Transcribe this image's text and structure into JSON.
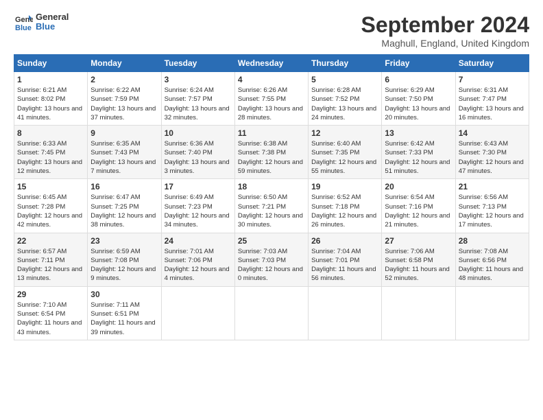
{
  "header": {
    "logo_line1": "General",
    "logo_line2": "Blue",
    "title": "September 2024",
    "location": "Maghull, England, United Kingdom"
  },
  "weekdays": [
    "Sunday",
    "Monday",
    "Tuesday",
    "Wednesday",
    "Thursday",
    "Friday",
    "Saturday"
  ],
  "weeks": [
    [
      {
        "day": "1",
        "sunrise": "6:21 AM",
        "sunset": "8:02 PM",
        "daylight": "13 hours and 41 minutes."
      },
      {
        "day": "2",
        "sunrise": "6:22 AM",
        "sunset": "7:59 PM",
        "daylight": "13 hours and 37 minutes."
      },
      {
        "day": "3",
        "sunrise": "6:24 AM",
        "sunset": "7:57 PM",
        "daylight": "13 hours and 32 minutes."
      },
      {
        "day": "4",
        "sunrise": "6:26 AM",
        "sunset": "7:55 PM",
        "daylight": "13 hours and 28 minutes."
      },
      {
        "day": "5",
        "sunrise": "6:28 AM",
        "sunset": "7:52 PM",
        "daylight": "13 hours and 24 minutes."
      },
      {
        "day": "6",
        "sunrise": "6:29 AM",
        "sunset": "7:50 PM",
        "daylight": "13 hours and 20 minutes."
      },
      {
        "day": "7",
        "sunrise": "6:31 AM",
        "sunset": "7:47 PM",
        "daylight": "13 hours and 16 minutes."
      }
    ],
    [
      {
        "day": "8",
        "sunrise": "6:33 AM",
        "sunset": "7:45 PM",
        "daylight": "13 hours and 12 minutes."
      },
      {
        "day": "9",
        "sunrise": "6:35 AM",
        "sunset": "7:43 PM",
        "daylight": "13 hours and 7 minutes."
      },
      {
        "day": "10",
        "sunrise": "6:36 AM",
        "sunset": "7:40 PM",
        "daylight": "13 hours and 3 minutes."
      },
      {
        "day": "11",
        "sunrise": "6:38 AM",
        "sunset": "7:38 PM",
        "daylight": "12 hours and 59 minutes."
      },
      {
        "day": "12",
        "sunrise": "6:40 AM",
        "sunset": "7:35 PM",
        "daylight": "12 hours and 55 minutes."
      },
      {
        "day": "13",
        "sunrise": "6:42 AM",
        "sunset": "7:33 PM",
        "daylight": "12 hours and 51 minutes."
      },
      {
        "day": "14",
        "sunrise": "6:43 AM",
        "sunset": "7:30 PM",
        "daylight": "12 hours and 47 minutes."
      }
    ],
    [
      {
        "day": "15",
        "sunrise": "6:45 AM",
        "sunset": "7:28 PM",
        "daylight": "12 hours and 42 minutes."
      },
      {
        "day": "16",
        "sunrise": "6:47 AM",
        "sunset": "7:25 PM",
        "daylight": "12 hours and 38 minutes."
      },
      {
        "day": "17",
        "sunrise": "6:49 AM",
        "sunset": "7:23 PM",
        "daylight": "12 hours and 34 minutes."
      },
      {
        "day": "18",
        "sunrise": "6:50 AM",
        "sunset": "7:21 PM",
        "daylight": "12 hours and 30 minutes."
      },
      {
        "day": "19",
        "sunrise": "6:52 AM",
        "sunset": "7:18 PM",
        "daylight": "12 hours and 26 minutes."
      },
      {
        "day": "20",
        "sunrise": "6:54 AM",
        "sunset": "7:16 PM",
        "daylight": "12 hours and 21 minutes."
      },
      {
        "day": "21",
        "sunrise": "6:56 AM",
        "sunset": "7:13 PM",
        "daylight": "12 hours and 17 minutes."
      }
    ],
    [
      {
        "day": "22",
        "sunrise": "6:57 AM",
        "sunset": "7:11 PM",
        "daylight": "12 hours and 13 minutes."
      },
      {
        "day": "23",
        "sunrise": "6:59 AM",
        "sunset": "7:08 PM",
        "daylight": "12 hours and 9 minutes."
      },
      {
        "day": "24",
        "sunrise": "7:01 AM",
        "sunset": "7:06 PM",
        "daylight": "12 hours and 4 minutes."
      },
      {
        "day": "25",
        "sunrise": "7:03 AM",
        "sunset": "7:03 PM",
        "daylight": "12 hours and 0 minutes."
      },
      {
        "day": "26",
        "sunrise": "7:04 AM",
        "sunset": "7:01 PM",
        "daylight": "11 hours and 56 minutes."
      },
      {
        "day": "27",
        "sunrise": "7:06 AM",
        "sunset": "6:58 PM",
        "daylight": "11 hours and 52 minutes."
      },
      {
        "day": "28",
        "sunrise": "7:08 AM",
        "sunset": "6:56 PM",
        "daylight": "11 hours and 48 minutes."
      }
    ],
    [
      {
        "day": "29",
        "sunrise": "7:10 AM",
        "sunset": "6:54 PM",
        "daylight": "11 hours and 43 minutes."
      },
      {
        "day": "30",
        "sunrise": "7:11 AM",
        "sunset": "6:51 PM",
        "daylight": "11 hours and 39 minutes."
      },
      {
        "day": "",
        "sunrise": "",
        "sunset": "",
        "daylight": ""
      },
      {
        "day": "",
        "sunrise": "",
        "sunset": "",
        "daylight": ""
      },
      {
        "day": "",
        "sunrise": "",
        "sunset": "",
        "daylight": ""
      },
      {
        "day": "",
        "sunrise": "",
        "sunset": "",
        "daylight": ""
      },
      {
        "day": "",
        "sunrise": "",
        "sunset": "",
        "daylight": ""
      }
    ]
  ]
}
